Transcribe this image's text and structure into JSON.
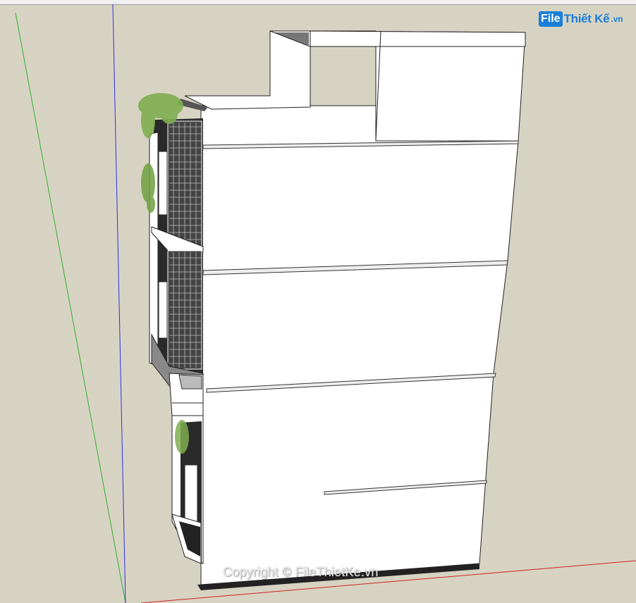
{
  "watermark": {
    "logo_box": "File",
    "logo_text": "Thiết Kế",
    "logo_suffix": ".vn",
    "copyright": "Copyright © FileThietKe.vn"
  },
  "colors": {
    "background": "#d7d3c3",
    "green_axis": "#2fae2f",
    "blue_axis": "#2f2fe0",
    "red_axis": "#d02020",
    "logo_blue": "#1a7fd8"
  },
  "icons": [
    "logo-icon"
  ]
}
